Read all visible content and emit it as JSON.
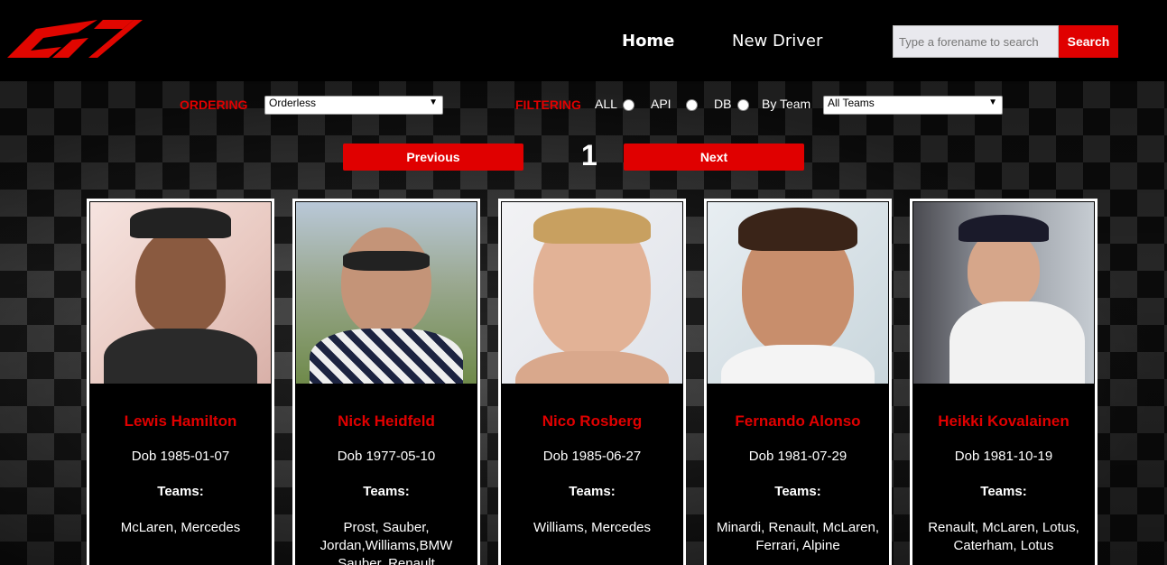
{
  "nav": {
    "home": "Home",
    "new_driver": "New Driver"
  },
  "search": {
    "placeholder": "Type a forename to search",
    "button": "Search"
  },
  "controls": {
    "ordering_label": "ORDERING",
    "ordering_value": "Orderless",
    "filtering_label": "FILTERING",
    "radio_all": "ALL",
    "radio_api": "API",
    "radio_db": "DB",
    "by_team_label": "By Team",
    "team_value": "All Teams"
  },
  "pagination": {
    "previous": "Previous",
    "page": "1",
    "next": "Next"
  },
  "teams_label": "Teams:",
  "colors": {
    "accent": "#e00000",
    "background": "#000000",
    "card_border": "#ffffff"
  },
  "drivers": [
    {
      "name": "Lewis Hamilton",
      "dob": "Dob 1985-01-07",
      "teams": "McLaren, Mercedes"
    },
    {
      "name": "Nick Heidfeld",
      "dob": "Dob 1977-05-10",
      "teams": "Prost, Sauber, Jordan,Williams,BMW Sauber, Renault"
    },
    {
      "name": "Nico Rosberg",
      "dob": "Dob 1985-06-27",
      "teams": "Williams, Mercedes"
    },
    {
      "name": "Fernando Alonso",
      "dob": "Dob 1981-07-29",
      "teams": "Minardi, Renault, McLaren, Ferrari, Alpine"
    },
    {
      "name": "Heikki Kovalainen",
      "dob": "Dob 1981-10-19",
      "teams": "Renault, McLaren, Lotus, Caterham, Lotus"
    }
  ]
}
